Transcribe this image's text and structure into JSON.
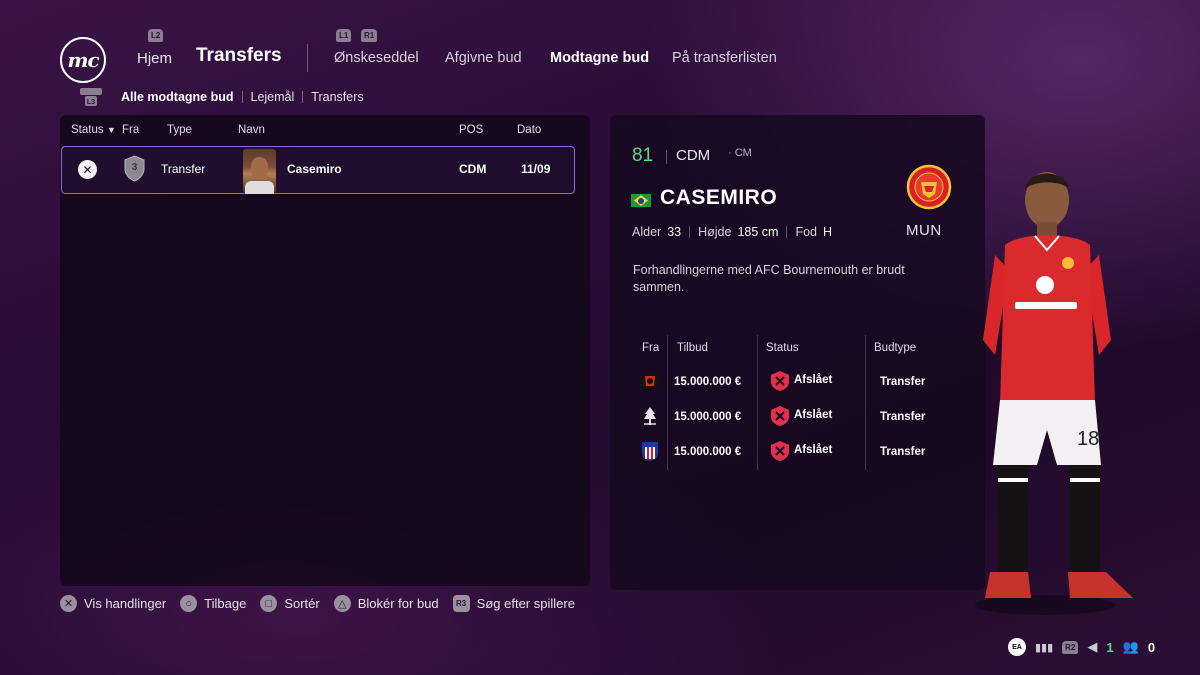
{
  "header": {
    "logo_text": "mc",
    "hint_l2": "L2",
    "hint_l1": "L1",
    "hint_r1": "R1",
    "home_label": "Hjem",
    "title": "Transfers",
    "tabs": [
      {
        "label": "Ønskeseddel",
        "active": false
      },
      {
        "label": "Afgivne bud",
        "active": false
      },
      {
        "label": "Modtagne bud",
        "active": true
      },
      {
        "label": "På transferlisten",
        "active": false
      }
    ]
  },
  "subnav": {
    "hint": "L3",
    "items": [
      {
        "label": "Alle modtagne bud",
        "active": true
      },
      {
        "label": "Lejemål",
        "active": false
      },
      {
        "label": "Transfers",
        "active": false
      }
    ]
  },
  "table": {
    "headers": {
      "status": "Status",
      "sort_arrow": "▼",
      "from": "Fra",
      "type": "Type",
      "name": "Navn",
      "pos": "POS",
      "date": "Dato"
    },
    "rows": [
      {
        "status_icon": "x-circle-icon",
        "from_tier": "3",
        "type": "Transfer",
        "name": "Casemiro",
        "pos": "CDM",
        "date": "11/09"
      }
    ]
  },
  "player": {
    "ovr": "81",
    "position": "CDM",
    "alt_position": "· CM",
    "nationality_icon": "brazil-flag-icon",
    "name": "CASEMIRO",
    "club_abbr": "MUN",
    "age_label": "Alder",
    "age": "33",
    "height_label": "Højde",
    "height": "185 cm",
    "foot_label": "Fod",
    "foot": "H",
    "message": "Forhandlingerne med AFC Bournemouth er brudt sammen."
  },
  "offers": {
    "headers": {
      "from": "Fra",
      "offer": "Tilbud",
      "status": "Status",
      "type": "Budtype"
    },
    "rows": [
      {
        "club_icon": "bournemouth-crest-icon",
        "amount": "15.000.000 €",
        "status": "Afslået",
        "type": "Transfer"
      },
      {
        "club_icon": "nottingham-forest-crest-icon",
        "amount": "15.000.000 €",
        "status": "Afslået",
        "type": "Transfer"
      },
      {
        "club_icon": "atletico-madrid-crest-icon",
        "amount": "15.000.000 €",
        "status": "Afslået",
        "type": "Transfer"
      }
    ]
  },
  "footer": {
    "actions": [
      {
        "icon": "cross-button-icon",
        "glyph": "✕",
        "label": "Vis handlinger"
      },
      {
        "icon": "circle-button-icon",
        "glyph": "○",
        "label": "Tilbage"
      },
      {
        "icon": "square-button-icon",
        "glyph": "□",
        "label": "Sortér"
      },
      {
        "icon": "triangle-button-icon",
        "glyph": "△",
        "label": "Blokér for bud"
      },
      {
        "icon": "r3-button-icon",
        "glyph": "R3",
        "label": "Søg efter spillere"
      }
    ],
    "tray": {
      "ea": "EA",
      "r2": "R2",
      "count_green": "1",
      "count_white": "0"
    }
  },
  "colors": {
    "accent_green": "#5fd88a",
    "selection_border": "#8f6ad6",
    "reject_red": "#e0304a"
  }
}
